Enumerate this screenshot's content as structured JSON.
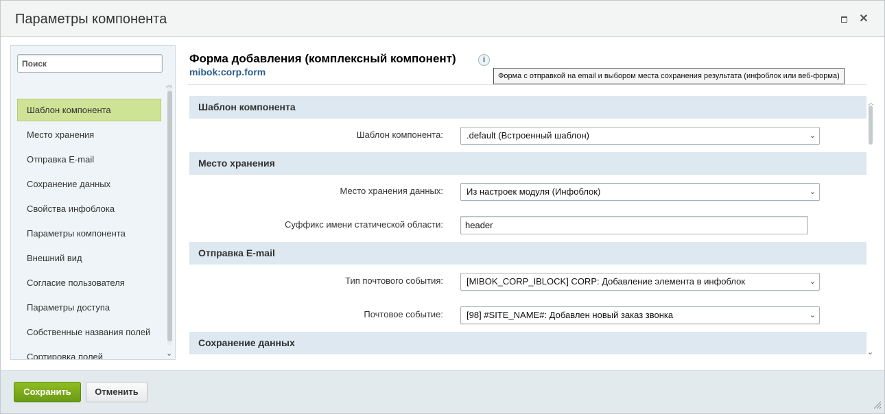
{
  "window": {
    "title": "Параметры компонента",
    "maximize_icon": "maximize-icon",
    "close_icon": "close-icon",
    "close_glyph": "✕"
  },
  "sidebar": {
    "search_placeholder": "Поиск",
    "items": [
      {
        "label": "Шаблон компонента",
        "active": true
      },
      {
        "label": "Место хранения"
      },
      {
        "label": "Отправка E-mail"
      },
      {
        "label": "Сохранение данных"
      },
      {
        "label": "Свойства инфоблока"
      },
      {
        "label": "Параметры компонента"
      },
      {
        "label": "Внешний вид"
      },
      {
        "label": "Согласие пользователя"
      },
      {
        "label": "Параметры доступа"
      },
      {
        "label": "Собственные названия полей"
      },
      {
        "label": "Сортировка полей"
      }
    ]
  },
  "component": {
    "title": "Форма добавления (комплексный компонент)",
    "code": "mibok:corp.form",
    "info_glyph": "i",
    "tooltip": "Форма с отправкой на email и выбором места сохранения результата (инфоблок или веб-форма)"
  },
  "sections": [
    {
      "heading": "Шаблон компонента",
      "fields": [
        {
          "label": "Шаблон компонента:",
          "type": "select",
          "value": ".default (Встроенный шаблон)"
        }
      ]
    },
    {
      "heading": "Место хранения",
      "fields": [
        {
          "label": "Место хранения данных:",
          "type": "select",
          "value": "Из настроек модуля (Инфоблок)"
        },
        {
          "label": "Суффикс имени статической области:",
          "type": "text",
          "value": "header"
        }
      ]
    },
    {
      "heading": "Отправка E-mail",
      "fields": [
        {
          "label": "Тип почтового события:",
          "type": "select",
          "value": "[MIBOK_CORP_IBLOCK] CORP: Добавление элемента в инфоблок"
        },
        {
          "label": "Почтовое событие:",
          "type": "select",
          "value": "[98] #SITE_NAME#: Добавлен новый заказ звонка"
        }
      ]
    },
    {
      "heading": "Сохранение данных",
      "fields": []
    }
  ],
  "footer": {
    "save_label": "Сохранить",
    "cancel_label": "Отменить"
  },
  "colors": {
    "active_item_bg": "#cfe397",
    "section_bg": "#dde8f1",
    "save_button": "#7aab1a",
    "code_link": "#2a5b8a"
  }
}
